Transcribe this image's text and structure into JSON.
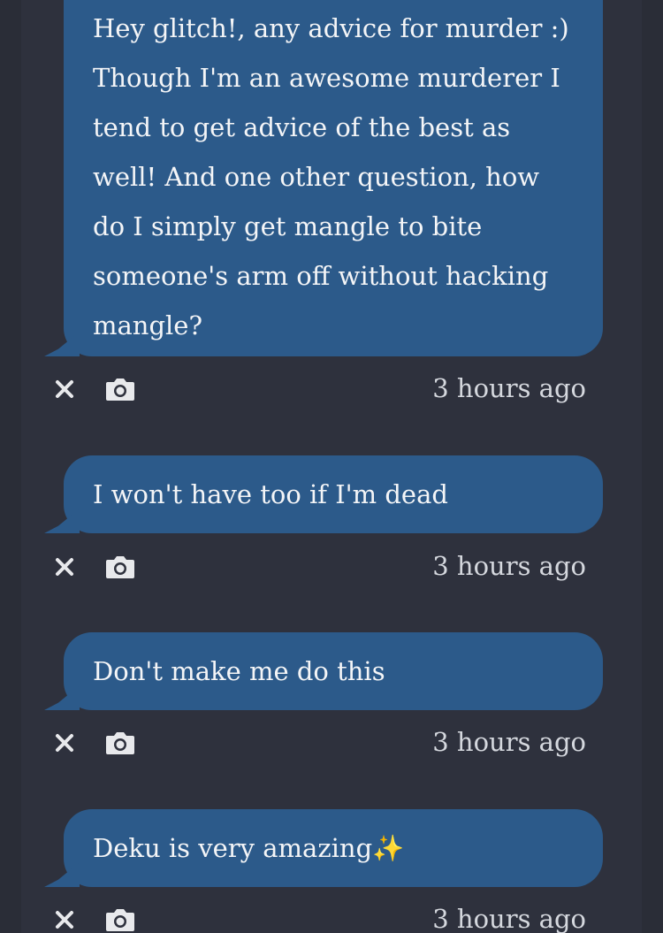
{
  "messages": [
    {
      "text": "Hey glitch!, any advice for murder :) Though I'm an awesome murderer I tend to get advice of the best as well! And one other question, how do I simply get mangle to bite someone's arm off without hacking mangle?",
      "timestamp": "3 hours ago"
    },
    {
      "text": "I won't have too if I'm dead",
      "timestamp": "3 hours ago"
    },
    {
      "text": "Don't make me do this",
      "timestamp": "3 hours ago"
    },
    {
      "text": "Deku is very amazing✨",
      "timestamp": "3 hours ago"
    }
  ],
  "icons": {
    "close": "close-icon",
    "camera": "camera-icon"
  },
  "colors": {
    "background": "#2a2d37",
    "feed_background": "#2e313d",
    "bubble": "#2c5a8a",
    "text": "#f4f5f7",
    "timestamp": "#d5d8de"
  }
}
